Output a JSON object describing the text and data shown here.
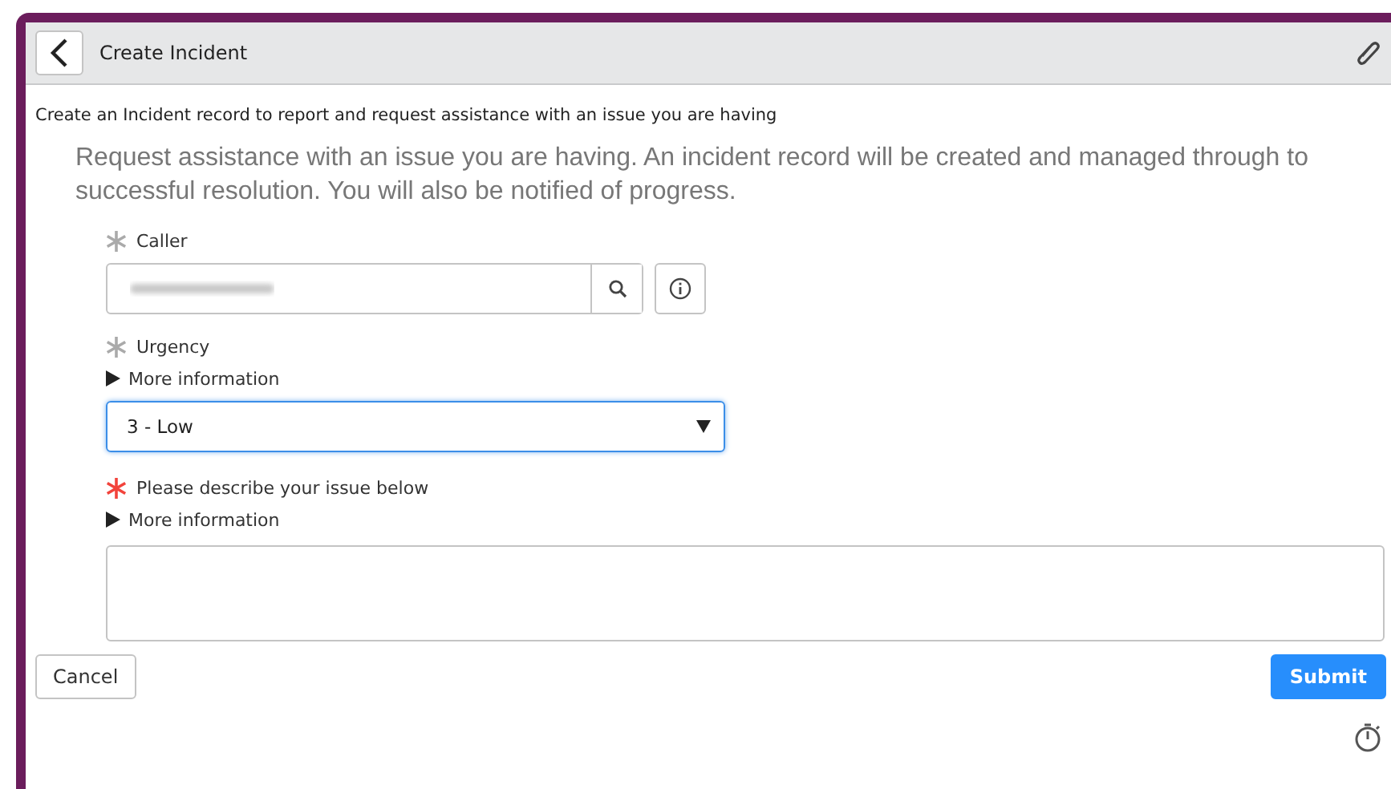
{
  "header": {
    "title": "Create Incident"
  },
  "subtitle": "Create an Incident record to report and request assistance with an issue you are having",
  "intro": "Request assistance with an issue you are having. An incident record will be created and managed through to successful resolution. You will also be notified of progress.",
  "fields": [
    {
      "kind": "reference",
      "label": "Caller",
      "required_filled": true
    },
    {
      "kind": "select",
      "label": "Urgency",
      "required_filled": true,
      "more_info": "More information",
      "value": "3 - Low",
      "focused": true
    },
    {
      "kind": "textarea",
      "label": "Please describe your issue below",
      "required_filled": false,
      "more_info": "More information"
    }
  ],
  "buttons": {
    "cancel": "Cancel",
    "submit": "Submit"
  }
}
